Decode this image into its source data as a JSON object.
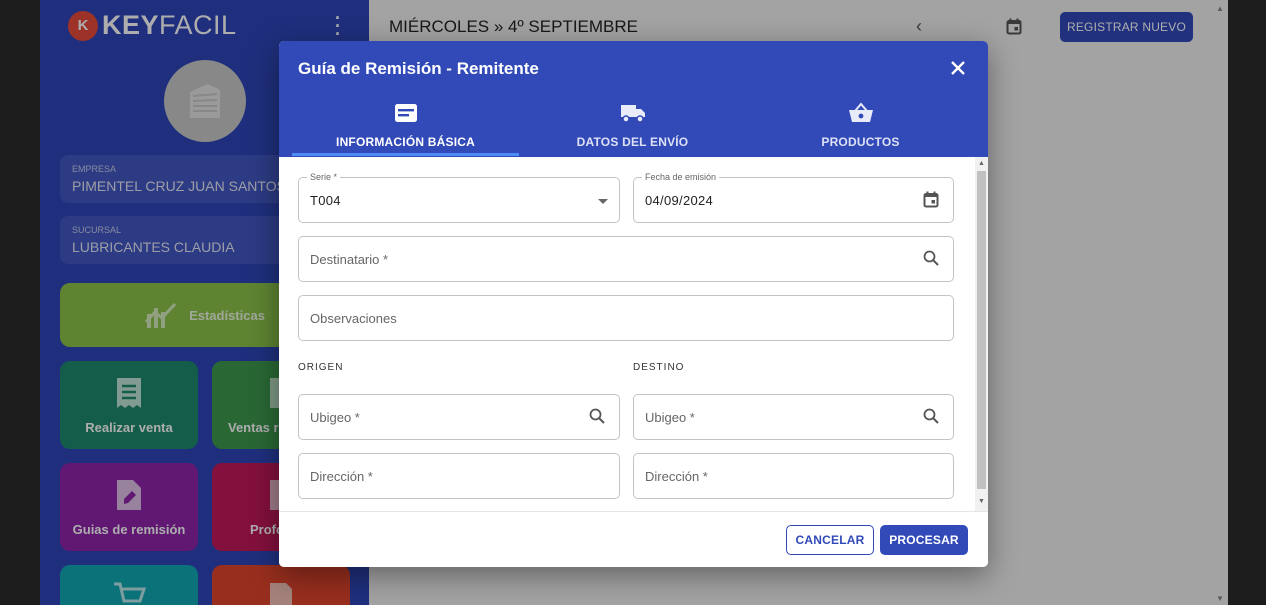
{
  "app": {
    "logo_text_bold": "KEY",
    "logo_text_light": "FACIL",
    "logo_mark": "K"
  },
  "sidebar": {
    "empresa_label": "EMPRESA",
    "empresa_value": "PIMENTEL CRUZ JUAN SANTOS",
    "sucursal_label": "SUCURSAL",
    "sucursal_value": "LUBRICANTES CLAUDIA",
    "tiles": [
      {
        "label": "Estadísticas",
        "color": "#8bc34a",
        "icon": "chart-trend-icon"
      },
      {
        "label": "Realizar venta",
        "color": "#1e8a6e",
        "icon": "receipt-icon"
      },
      {
        "label": "Ventas re",
        "color": "#3d9a4f",
        "icon": "document-icon"
      },
      {
        "label": "Guias de remisión",
        "color": "#8e24aa",
        "icon": "file-edit-icon"
      },
      {
        "label": "Profc",
        "color": "#c2185b",
        "icon": "document-icon"
      },
      {
        "label": "",
        "color": "#13a9b3",
        "icon": "cart-icon"
      },
      {
        "label": "",
        "color": "#e0442d",
        "icon": "pdf-icon"
      }
    ]
  },
  "header": {
    "date_title": "MIÉRCOLES » 4º SEPTIEMBRE",
    "register_button": "REGISTRAR NUEVO"
  },
  "dialog": {
    "title": "Guía de Remisión - Remitente",
    "tabs": [
      {
        "label": "INFORMACIÓN BÁSICA",
        "icon": "card-icon",
        "active": true
      },
      {
        "label": "DATOS DEL ENVÍO",
        "icon": "truck-icon",
        "active": false
      },
      {
        "label": "PRODUCTOS",
        "icon": "basket-icon",
        "active": false
      }
    ],
    "serie": {
      "label": "Serie *",
      "value": "T004"
    },
    "fecha": {
      "label": "Fecha de emisión",
      "value": "04/09/2024"
    },
    "destinatario": {
      "placeholder": "Destinatario *"
    },
    "observaciones": {
      "placeholder": "Observaciones"
    },
    "origen_title": "ORIGEN",
    "destino_title": "DESTINO",
    "origen_ubigeo": {
      "placeholder": "Ubigeo *"
    },
    "origen_direccion": {
      "placeholder": "Dirección *"
    },
    "destino_ubigeo": {
      "placeholder": "Ubigeo *"
    },
    "destino_direccion": {
      "placeholder": "Dirección *"
    },
    "cancel_button": "CANCELAR",
    "process_button": "PROCESAR"
  }
}
